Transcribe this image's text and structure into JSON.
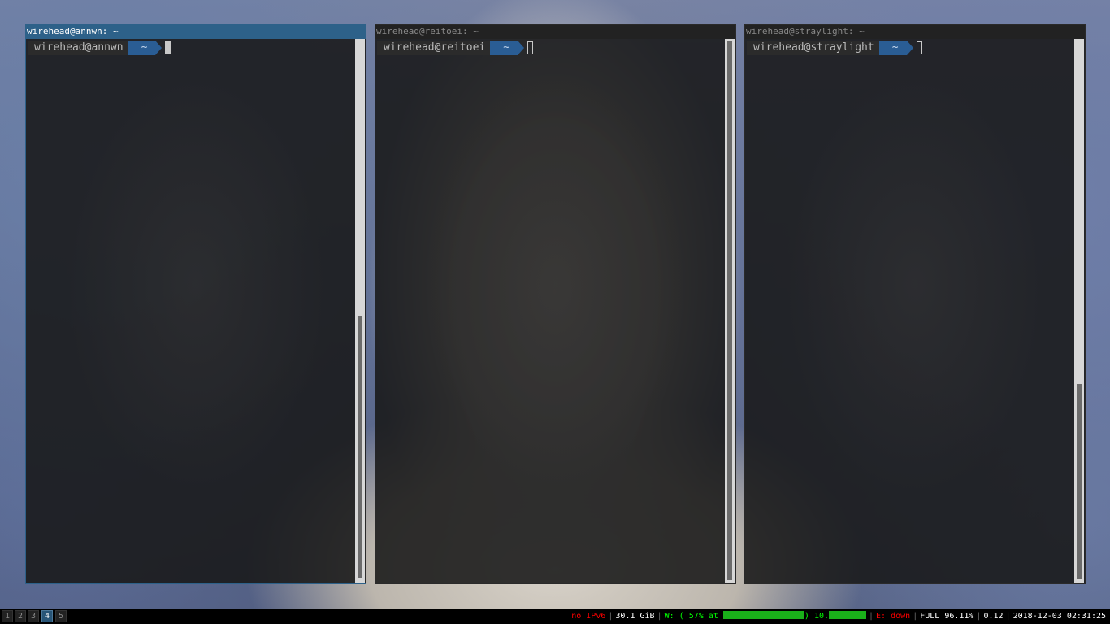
{
  "wallpaper": {
    "icon": "wallpaper-portrait-woman"
  },
  "windows": [
    {
      "title": "wirehead@annwn: ~",
      "prompt_user": "wirehead@annwn",
      "prompt_dir": "~",
      "focused": true
    },
    {
      "title": "wirehead@reitoei: ~",
      "prompt_user": "wirehead@reitoei",
      "prompt_dir": "~",
      "focused": false
    },
    {
      "title": "wirehead@straylight: ~",
      "prompt_user": "wirehead@straylight",
      "prompt_dir": "~",
      "focused": false
    }
  ],
  "workspaces": [
    {
      "label": "1",
      "active": false
    },
    {
      "label": "2",
      "active": false
    },
    {
      "label": "3",
      "active": false
    },
    {
      "label": "4",
      "active": true
    },
    {
      "label": "5",
      "active": false
    }
  ],
  "status": {
    "ipv6": "no IPv6",
    "disk": "30.1 GiB",
    "wifi_prefix": "W: ( 57% at",
    "wifi_paren": ")",
    "wifi_ip": "10.",
    "ethernet": "E: down",
    "battery": "FULL 96.11%",
    "load": "0.12",
    "datetime": "2018-12-03 02:31:25"
  },
  "colors": {
    "focused_border": "#2d6189",
    "status_red": "#ff0000",
    "status_green": "#00ff00",
    "active_workspace": "#285577"
  }
}
